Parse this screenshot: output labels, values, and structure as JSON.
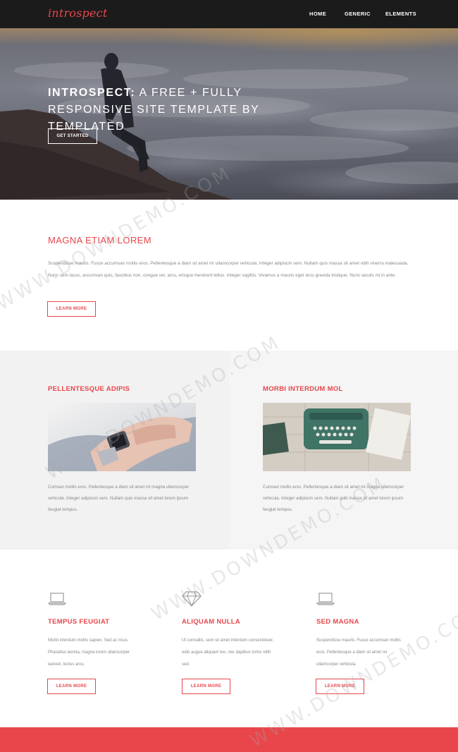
{
  "header": {
    "logo": "introspect",
    "nav": [
      "Home",
      "Generic",
      "Elements"
    ]
  },
  "hero": {
    "title_bold": "Introspect:",
    "title_rest": " A free + fully responsive site template by TEMPLATED",
    "button": "Get Started"
  },
  "section1": {
    "title": "Magna Etiam Lorem",
    "body": "Suspendisse mauris. Fusce accumsan mollis eros. Pellentesque a diam sit amet mi ullamcorper vehicula. Integer adipiscin sem. Nullam quis massa sit amet nibh viverra malesuada. Nunc sem lacus, accumsan quis, faucibus non, congue vel, arcu, erisque hendrerit tellus. Integer sagittis. Vivamus a mauris eget arcu gravida tristique. Nunc iaculis mi in ante.",
    "button": "Learn More"
  },
  "section2": {
    "left": {
      "title": "Pellentesque adipis",
      "text": "Cumsan mollis eros. Pellentesque a diam sit amet mi magna ullamcorper vehicula. Integer adipiscin sem. Nullam quis massa sit amet lorem ipsum feugiat tempus."
    },
    "right": {
      "title": "Morbi interdum mol",
      "text": "Cumsan mollis eros. Pellentesque a diam sit amet mi magna ullamcorper vehicula. Integer adipiscin sem. Nullam quis massa sit amet lorem ipsum feugiat tempus."
    }
  },
  "section3": {
    "features": [
      {
        "icon": "laptop-icon",
        "title": "Tempus Feugiat",
        "text": "Morbi interdum mollis sapien. Sed ac risus. Phasellus lacinia, magna lorem ullamcorper laoreet, lectus arcu.",
        "button": "Learn More"
      },
      {
        "icon": "diamond-icon",
        "title": "Aliquam Nulla",
        "text": "Ut convallis, sem sit amet interdum consectetuer, odio augue aliquam leo, nec dapibus tortor nibh sed.",
        "button": "Learn More"
      },
      {
        "icon": "laptop-icon",
        "title": "Sed Magna",
        "text": "Suspendisse mauris. Fusce accumsan mollis eros. Pellentesque a diam sit amet mi ullamcorper vehicula.",
        "button": "Learn More"
      }
    ]
  },
  "watermark": "WWW.DOWNDEMO.COM",
  "colors": {
    "accent": "#e8464b",
    "header_bg": "#1b1b1b",
    "alt_section_bg": "#f4f4f4"
  }
}
